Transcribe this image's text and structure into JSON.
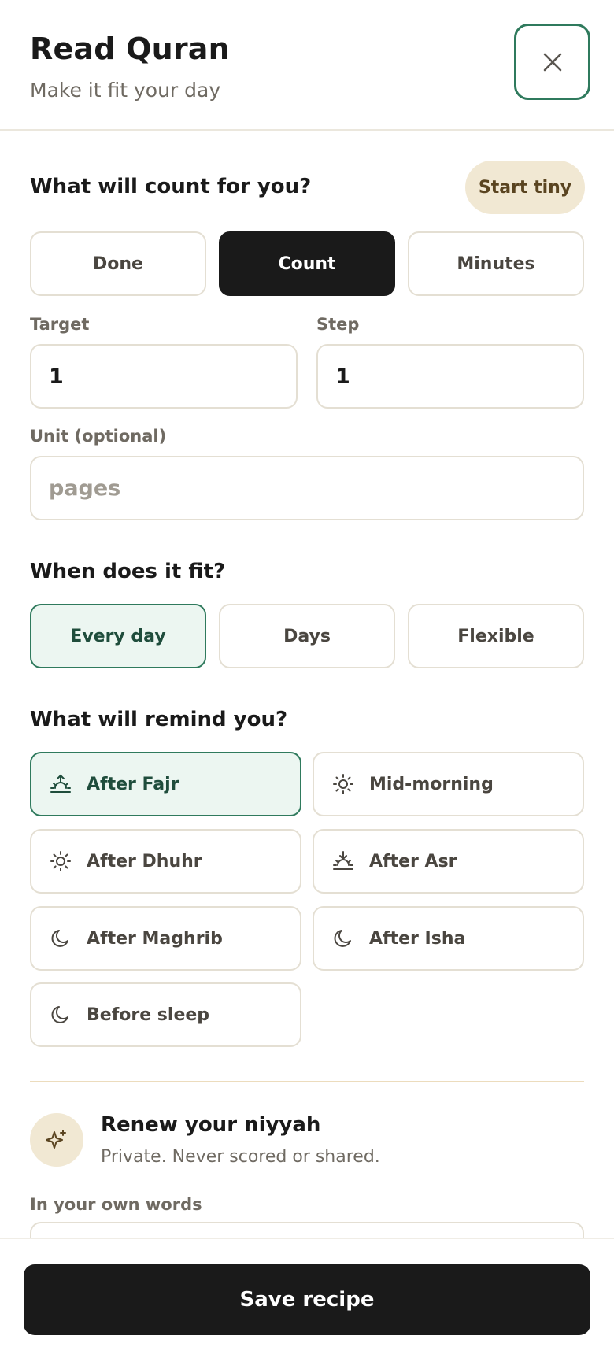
{
  "header": {
    "title": "Read Quran",
    "subtitle": "Make it fit your day",
    "close_icon": "close-icon"
  },
  "counting": {
    "title": "What will count for you?",
    "start_tiny": "Start tiny",
    "options": [
      "Done",
      "Count",
      "Minutes"
    ],
    "selected": "Count"
  },
  "fields": {
    "target_label": "Target",
    "target_value": "1",
    "step_label": "Step",
    "step_value": "1",
    "unit_label": "Unit (optional)",
    "unit_placeholder": "pages"
  },
  "schedule": {
    "title": "When does it fit?",
    "options": [
      "Every day",
      "Days",
      "Flexible"
    ],
    "selected": "Every day"
  },
  "reminders": {
    "title": "What will remind you?",
    "options": [
      {
        "label": "After Fajr",
        "icon": "sunrise-icon"
      },
      {
        "label": "Mid-morning",
        "icon": "sun-icon"
      },
      {
        "label": "After Dhuhr",
        "icon": "sun-icon"
      },
      {
        "label": "After Asr",
        "icon": "sunset-icon"
      },
      {
        "label": "After Maghrib",
        "icon": "moon-icon"
      },
      {
        "label": "After Isha",
        "icon": "moon-icon"
      },
      {
        "label": "Before sleep",
        "icon": "moon-icon"
      }
    ],
    "selected": "After Fajr"
  },
  "niyyah": {
    "icon": "sparkle-icon",
    "title": "Renew your niyyah",
    "subtitle": "Private. Never scored or shared.",
    "own_words_label": "In your own words"
  },
  "footer": {
    "save_label": "Save recipe"
  },
  "colors": {
    "accent": "#2f7a5d",
    "selected_bg": "#ecf6f1",
    "pill_bg": "#f1e8d3",
    "dark": "#1a1a1a"
  }
}
